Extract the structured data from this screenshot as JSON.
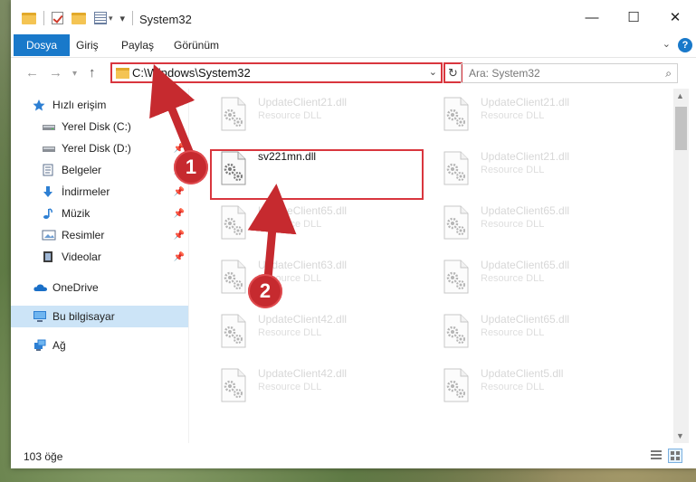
{
  "window": {
    "title": "System32",
    "minimize_glyph": "—",
    "maximize_glyph": "☐",
    "close_glyph": "✕"
  },
  "ribbon": {
    "tabs": [
      {
        "label": "Dosya",
        "active": true
      },
      {
        "label": "Giriş"
      },
      {
        "label": "Paylaş"
      },
      {
        "label": "Görünüm"
      }
    ],
    "help": "?"
  },
  "address": {
    "path": "C:\\Windows\\System32",
    "search_placeholder": "Ara: System32"
  },
  "sidebar": {
    "items": [
      {
        "label": "Hızlı erişim",
        "icon": "star-icon",
        "pinned": false
      },
      {
        "label": "Yerel Disk (C:)",
        "icon": "drive-icon",
        "pinned": false
      },
      {
        "label": "Yerel Disk (D:)",
        "icon": "drive-icon",
        "pinned": false
      },
      {
        "label": "Belgeler",
        "icon": "documents-icon",
        "pinned": false
      },
      {
        "label": "İndirmeler",
        "icon": "download-icon",
        "pinned": true
      },
      {
        "label": "Müzik",
        "icon": "music-icon",
        "pinned": true
      },
      {
        "label": "Resimler",
        "icon": "pictures-icon",
        "pinned": true
      },
      {
        "label": "Videolar",
        "icon": "video-icon",
        "pinned": true
      },
      {
        "label": "OneDrive",
        "icon": "cloud-icon",
        "pinned": false
      },
      {
        "label": "Bu bilgisayar",
        "icon": "computer-icon",
        "pinned": false,
        "selected": true
      },
      {
        "label": "Ağ",
        "icon": "network-icon",
        "pinned": false
      }
    ]
  },
  "files": [
    {
      "name": "UpdateClient21.dll",
      "desc": "Resource DLL"
    },
    {
      "name": "UpdateClient21.dll",
      "desc": "Resource DLL"
    },
    {
      "name": "sv221mn.dll",
      "desc": ""
    },
    {
      "name": "UpdateClient21.dll",
      "desc": "Resource DLL"
    },
    {
      "name": "UpdateClient65.dll",
      "desc": "Resource DLL"
    },
    {
      "name": "UpdateClient65.dll",
      "desc": "Resource DLL"
    },
    {
      "name": "UpdateClient63.dll",
      "desc": "Resource DLL"
    },
    {
      "name": "UpdateClient65.dll",
      "desc": "Resource DLL"
    },
    {
      "name": "UpdateClient42.dll",
      "desc": "Resource DLL"
    },
    {
      "name": "UpdateClient65.dll",
      "desc": "Resource DLL"
    },
    {
      "name": "UpdateClient42.dll",
      "desc": "Resource DLL"
    },
    {
      "name": "UpdateClient5.dll",
      "desc": "Resource DLL"
    }
  ],
  "status": {
    "count": "103 öğe"
  },
  "annotations": {
    "step1": "1",
    "step2": "2",
    "color": "#c62a2f"
  }
}
